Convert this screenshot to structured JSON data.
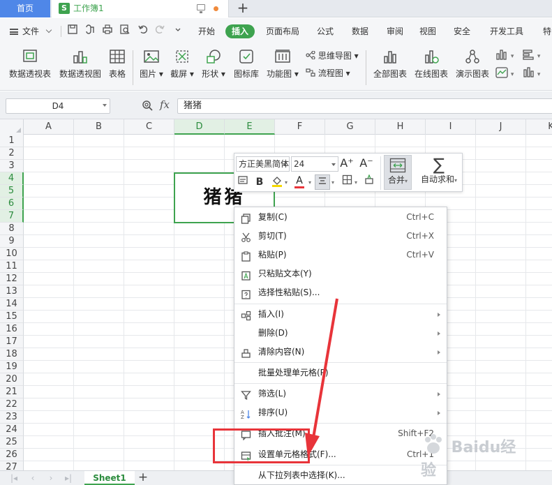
{
  "tabs": {
    "home": "首页",
    "workbook_logo": "S",
    "workbook": "工作簿1",
    "add": "+"
  },
  "menubar": {
    "file": "文件",
    "tabs": [
      "开始",
      "插入",
      "页面布局",
      "公式",
      "数据",
      "审阅",
      "视图",
      "安全",
      "开发工具",
      "特"
    ],
    "active_tab": "插入"
  },
  "ribbon": {
    "pivot_table": "数据透视表",
    "pivot_chart": "数据透视图",
    "table": "表格",
    "picture": "图片",
    "screenshot": "截屏",
    "shape": "形状",
    "icon_lib": "图标库",
    "function_chart": "功能图",
    "mindmap": "思维导图",
    "flowchart": "流程图",
    "all_charts": "全部图表",
    "online_charts": "在线图表",
    "presentation_chart": "演示图表"
  },
  "formula_bar": {
    "name_box": "D4",
    "fx": "fx",
    "content": "猪猪"
  },
  "grid": {
    "columns": [
      "A",
      "B",
      "C",
      "D",
      "E",
      "F",
      "G",
      "H",
      "I",
      "J",
      "K"
    ],
    "rows": [
      "1",
      "2",
      "3",
      "4",
      "5",
      "6",
      "7",
      "8",
      "9",
      "10",
      "11",
      "12",
      "13",
      "14",
      "15",
      "16",
      "17",
      "18",
      "19",
      "20",
      "21",
      "22",
      "23",
      "24",
      "25",
      "26",
      "27"
    ],
    "merged_cell_text": "猪猪"
  },
  "sheetbar": {
    "sheet": "Sheet1",
    "add": "+"
  },
  "mini_toolbar": {
    "font": "方正美黑简体",
    "size": "24",
    "grow": "A⁺",
    "shrink": "A⁻",
    "bold": "B",
    "font_color": "A",
    "merge": "合并",
    "autosum": "自动求和"
  },
  "context_menu": {
    "items": [
      {
        "label": "复制(C)",
        "shortcut": "Ctrl+C"
      },
      {
        "label": "剪切(T)",
        "shortcut": "Ctrl+X"
      },
      {
        "label": "粘贴(P)",
        "shortcut": "Ctrl+V"
      },
      {
        "label": "只粘贴文本(Y)",
        "shortcut": ""
      },
      {
        "label": "选择性粘贴(S)...",
        "shortcut": ""
      },
      {
        "label": "插入(I)",
        "shortcut": ""
      },
      {
        "label": "删除(D)",
        "shortcut": ""
      },
      {
        "label": "清除内容(N)",
        "shortcut": ""
      },
      {
        "label": "批量处理单元格(P)",
        "shortcut": ""
      },
      {
        "label": "筛选(L)",
        "shortcut": ""
      },
      {
        "label": "排序(U)",
        "shortcut": ""
      },
      {
        "label": "插入批注(M)...",
        "shortcut": "Shift+F2"
      },
      {
        "label": "设置单元格格式(F)...",
        "shortcut": "Ctrl+1"
      },
      {
        "label": "从下拉列表中选择(K)...",
        "shortcut": ""
      }
    ]
  },
  "colors": {
    "accent_green": "#3ea34f",
    "home_tab_blue": "#4f87e8",
    "annotation_red": "#e8343a"
  },
  "watermark": "Baidu经验"
}
